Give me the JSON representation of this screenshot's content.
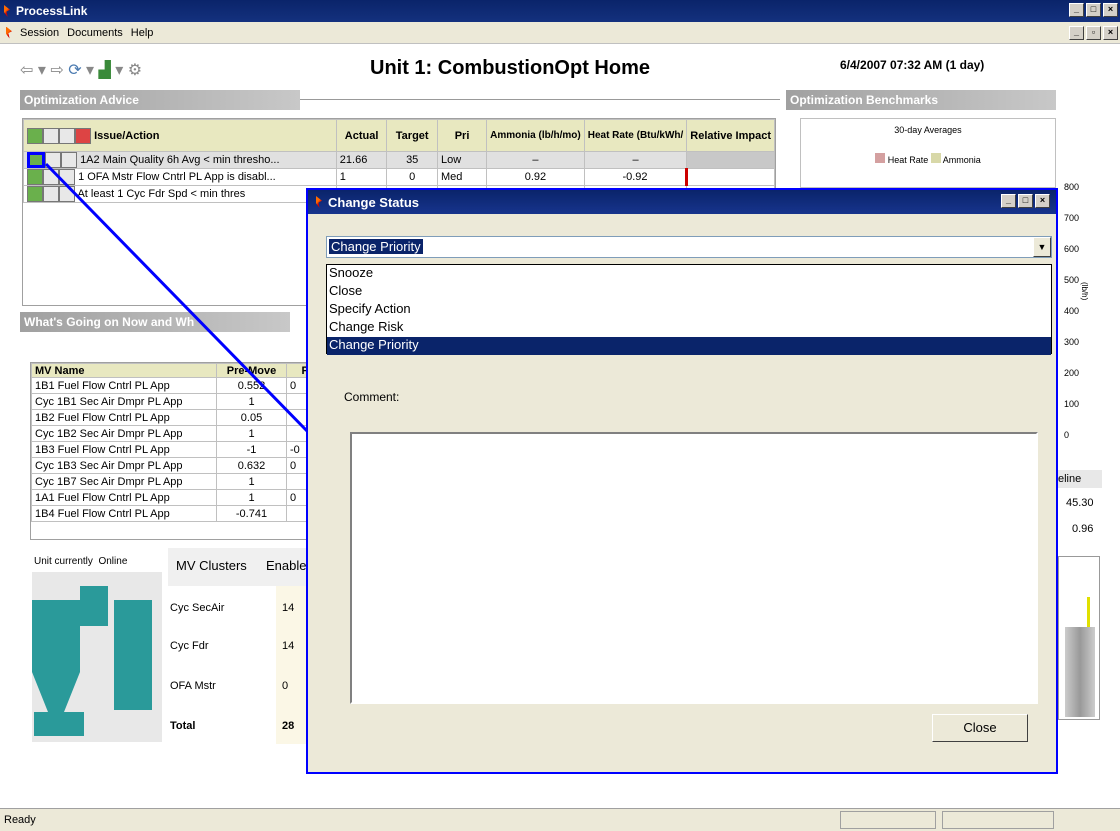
{
  "window": {
    "title": "ProcessLink"
  },
  "menu": {
    "session": "Session",
    "documents": "Documents",
    "help": "Help"
  },
  "header": {
    "title": "Unit 1: CombustionOpt Home",
    "timestamp": "6/4/2007 07:32 AM (1 day)"
  },
  "advice": {
    "section_title": "Optimization Advice",
    "columns": [
      "Issue/Action",
      "Actual",
      "Target",
      "Pri",
      "Ammonia (lb/h/mo)",
      "Heat Rate (Btu/kWh/",
      "Relative Impact"
    ],
    "rows": [
      {
        "issue": "1A2  Main Quality 6h Avg < min thresho...",
        "actual": "21.66",
        "target": "35",
        "pri": "Low",
        "ammonia": "–",
        "heat_rate": "–"
      },
      {
        "issue": "1 OFA Mstr Flow Cntrl PL App is disabl...",
        "actual": "1",
        "target": "0",
        "pri": "Med",
        "ammonia": "0.92",
        "heat_rate": "-0.92"
      },
      {
        "issue": "At least 1 Cyc Fdr Spd < min thres",
        "actual": "",
        "target": "",
        "pri": "",
        "ammonia": "",
        "heat_rate": ""
      }
    ]
  },
  "whats_going_on": {
    "section_title": "What's Going on Now and Wh",
    "columns": [
      "MV Name",
      "Pre-Move",
      "Po"
    ],
    "rows": [
      {
        "name": "1B1 Fuel Flow Cntrl PL App",
        "pre": "0.552",
        "post": "0"
      },
      {
        "name": "Cyc 1B1 Sec Air Dmpr PL App",
        "pre": "1",
        "post": ""
      },
      {
        "name": "1B2 Fuel Flow Cntrl PL App",
        "pre": "0.05",
        "post": ""
      },
      {
        "name": "Cyc 1B2 Sec Air Dmpr PL App",
        "pre": "1",
        "post": ""
      },
      {
        "name": "1B3 Fuel Flow Cntrl PL App",
        "pre": "-1",
        "post": "-0"
      },
      {
        "name": "Cyc 1B3 Sec Air Dmpr PL App",
        "pre": "0.632",
        "post": "0"
      },
      {
        "name": "Cyc 1B7 Sec Air Dmpr PL App",
        "pre": "1",
        "post": ""
      },
      {
        "name": "1A1 Fuel Flow Cntrl PL App",
        "pre": "1",
        "post": "0"
      },
      {
        "name": "1B4 Fuel Flow Cntrl PL App",
        "pre": "-0.741",
        "post": ""
      }
    ]
  },
  "unit_status": {
    "label": "Unit currently",
    "value": "Online"
  },
  "clusters": {
    "header_name": "MV Clusters",
    "header_enabled": "Enable",
    "rows": [
      {
        "name": "Cyc SecAir",
        "enabled": "14"
      },
      {
        "name": "Cyc Fdr",
        "enabled": "14"
      },
      {
        "name": "OFA Mstr",
        "enabled": "0"
      },
      {
        "name": "Total",
        "enabled": "28"
      }
    ]
  },
  "benchmarks": {
    "section_title": "Optimization Benchmarks",
    "chart_title": "30-day Averages",
    "legend_heat": "Heat Rate",
    "legend_ammonia": "Ammonia",
    "right_axis": [
      "800",
      "700",
      "600",
      "500",
      "400",
      "300",
      "200",
      "100",
      "0"
    ],
    "axis_unit": "(lb/h)",
    "baseline_label": "eline",
    "values": [
      "45.30",
      "0.96"
    ]
  },
  "dialog": {
    "title": "Change Status",
    "selected": "Change Priority",
    "options": [
      "Snooze",
      "Close",
      "Specify Action",
      "Change Risk",
      "Change Priority"
    ],
    "comment_label": "Comment:",
    "close_label": "Close"
  },
  "status": {
    "text": "Ready"
  },
  "colors": {
    "titlebar": "#0a246a",
    "highlight": "#0000ff",
    "heat_rate": "#d4a0a0",
    "ammonia": "#d8d8a8"
  }
}
